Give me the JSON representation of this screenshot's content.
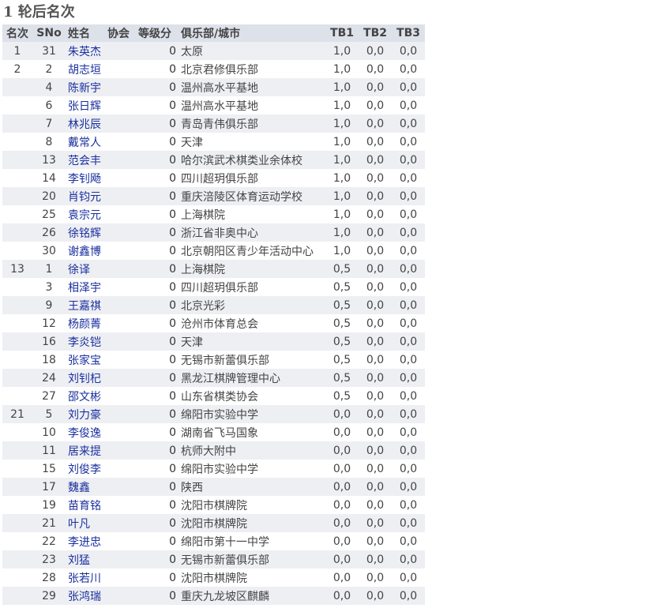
{
  "page": {
    "title": "1 轮后名次"
  },
  "table": {
    "headers": {
      "rank": "名次",
      "sno": "SNo",
      "name": "姓名",
      "fed": "协会",
      "rating": "等级分",
      "club": "俱乐部/城市",
      "tb1": "TB1",
      "tb2": "TB2",
      "tb3": "TB3"
    },
    "rows": [
      {
        "rank": "1",
        "sno": "31",
        "name": "朱英杰",
        "fed": "",
        "rating": "0",
        "club": "太原",
        "tb1": "1,0",
        "tb2": "0,0",
        "tb3": "0,0"
      },
      {
        "rank": "2",
        "sno": "2",
        "name": "胡志垣",
        "fed": "",
        "rating": "0",
        "club": "北京君修俱乐部",
        "tb1": "1,0",
        "tb2": "0,0",
        "tb3": "0,0"
      },
      {
        "rank": "",
        "sno": "4",
        "name": "陈新宇",
        "fed": "",
        "rating": "0",
        "club": "温州高水平基地",
        "tb1": "1,0",
        "tb2": "0,0",
        "tb3": "0,0"
      },
      {
        "rank": "",
        "sno": "6",
        "name": "张日辉",
        "fed": "",
        "rating": "0",
        "club": "温州高水平基地",
        "tb1": "1,0",
        "tb2": "0,0",
        "tb3": "0,0"
      },
      {
        "rank": "",
        "sno": "7",
        "name": "林兆辰",
        "fed": "",
        "rating": "0",
        "club": "青岛青伟俱乐部",
        "tb1": "1,0",
        "tb2": "0,0",
        "tb3": "0,0"
      },
      {
        "rank": "",
        "sno": "8",
        "name": "戴常人",
        "fed": "",
        "rating": "0",
        "club": "天津",
        "tb1": "1,0",
        "tb2": "0,0",
        "tb3": "0,0"
      },
      {
        "rank": "",
        "sno": "13",
        "name": "范会丰",
        "fed": "",
        "rating": "0",
        "club": "哈尔滨武术棋类业余体校",
        "tb1": "1,0",
        "tb2": "0,0",
        "tb3": "0,0"
      },
      {
        "rank": "",
        "sno": "14",
        "name": "李钊飏",
        "fed": "",
        "rating": "0",
        "club": "四川超玥俱乐部",
        "tb1": "1,0",
        "tb2": "0,0",
        "tb3": "0,0"
      },
      {
        "rank": "",
        "sno": "20",
        "name": "肖钧元",
        "fed": "",
        "rating": "0",
        "club": "重庆涪陵区体育运动学校",
        "tb1": "1,0",
        "tb2": "0,0",
        "tb3": "0,0"
      },
      {
        "rank": "",
        "sno": "25",
        "name": "袁宗元",
        "fed": "",
        "rating": "0",
        "club": "上海棋院",
        "tb1": "1,0",
        "tb2": "0,0",
        "tb3": "0,0"
      },
      {
        "rank": "",
        "sno": "26",
        "name": "徐铭辉",
        "fed": "",
        "rating": "0",
        "club": "浙江省非奥中心",
        "tb1": "1,0",
        "tb2": "0,0",
        "tb3": "0,0"
      },
      {
        "rank": "",
        "sno": "30",
        "name": "谢鑫博",
        "fed": "",
        "rating": "0",
        "club": "北京朝阳区青少年活动中心",
        "tb1": "1,0",
        "tb2": "0,0",
        "tb3": "0,0"
      },
      {
        "rank": "13",
        "sno": "1",
        "name": "徐译",
        "fed": "",
        "rating": "0",
        "club": "上海棋院",
        "tb1": "0,5",
        "tb2": "0,0",
        "tb3": "0,0"
      },
      {
        "rank": "",
        "sno": "3",
        "name": "相泽宇",
        "fed": "",
        "rating": "0",
        "club": "四川超玥俱乐部",
        "tb1": "0,5",
        "tb2": "0,0",
        "tb3": "0,0"
      },
      {
        "rank": "",
        "sno": "9",
        "name": "王嘉祺",
        "fed": "",
        "rating": "0",
        "club": "北京光彩",
        "tb1": "0,5",
        "tb2": "0,0",
        "tb3": "0,0"
      },
      {
        "rank": "",
        "sno": "12",
        "name": "杨颜菁",
        "fed": "",
        "rating": "0",
        "club": "沧州市体育总会",
        "tb1": "0,5",
        "tb2": "0,0",
        "tb3": "0,0"
      },
      {
        "rank": "",
        "sno": "16",
        "name": "李炎铠",
        "fed": "",
        "rating": "0",
        "club": "天津",
        "tb1": "0,5",
        "tb2": "0,0",
        "tb3": "0,0"
      },
      {
        "rank": "",
        "sno": "18",
        "name": "张家宝",
        "fed": "",
        "rating": "0",
        "club": "无锡市新蕾俱乐部",
        "tb1": "0,5",
        "tb2": "0,0",
        "tb3": "0,0"
      },
      {
        "rank": "",
        "sno": "24",
        "name": "刘钊杞",
        "fed": "",
        "rating": "0",
        "club": "黑龙江棋牌管理中心",
        "tb1": "0,5",
        "tb2": "0,0",
        "tb3": "0,0"
      },
      {
        "rank": "",
        "sno": "27",
        "name": "邵文彬",
        "fed": "",
        "rating": "0",
        "club": "山东省棋类协会",
        "tb1": "0,5",
        "tb2": "0,0",
        "tb3": "0,0"
      },
      {
        "rank": "21",
        "sno": "5",
        "name": "刘力豪",
        "fed": "",
        "rating": "0",
        "club": "绵阳市实验中学",
        "tb1": "0,0",
        "tb2": "0,0",
        "tb3": "0,0"
      },
      {
        "rank": "",
        "sno": "10",
        "name": "李俊逸",
        "fed": "",
        "rating": "0",
        "club": "湖南省飞马国象",
        "tb1": "0,0",
        "tb2": "0,0",
        "tb3": "0,0"
      },
      {
        "rank": "",
        "sno": "11",
        "name": "居来提",
        "fed": "",
        "rating": "0",
        "club": "杭师大附中",
        "tb1": "0,0",
        "tb2": "0,0",
        "tb3": "0,0"
      },
      {
        "rank": "",
        "sno": "15",
        "name": "刘俊李",
        "fed": "",
        "rating": "0",
        "club": "绵阳市实验中学",
        "tb1": "0,0",
        "tb2": "0,0",
        "tb3": "0,0"
      },
      {
        "rank": "",
        "sno": "17",
        "name": "魏鑫",
        "fed": "",
        "rating": "0",
        "club": "陕西",
        "tb1": "0,0",
        "tb2": "0,0",
        "tb3": "0,0"
      },
      {
        "rank": "",
        "sno": "19",
        "name": "苗育铭",
        "fed": "",
        "rating": "0",
        "club": "沈阳市棋牌院",
        "tb1": "0,0",
        "tb2": "0,0",
        "tb3": "0,0"
      },
      {
        "rank": "",
        "sno": "21",
        "name": "叶凡",
        "fed": "",
        "rating": "0",
        "club": "沈阳市棋牌院",
        "tb1": "0,0",
        "tb2": "0,0",
        "tb3": "0,0"
      },
      {
        "rank": "",
        "sno": "22",
        "name": "李进忠",
        "fed": "",
        "rating": "0",
        "club": "绵阳市第十一中学",
        "tb1": "0,0",
        "tb2": "0,0",
        "tb3": "0,0"
      },
      {
        "rank": "",
        "sno": "23",
        "name": "刘猛",
        "fed": "",
        "rating": "0",
        "club": "无锡市新蕾俱乐部",
        "tb1": "0,0",
        "tb2": "0,0",
        "tb3": "0,0"
      },
      {
        "rank": "",
        "sno": "28",
        "name": "张若川",
        "fed": "",
        "rating": "0",
        "club": "沈阳市棋牌院",
        "tb1": "0,0",
        "tb2": "0,0",
        "tb3": "0,0"
      },
      {
        "rank": "",
        "sno": "29",
        "name": "张鸿瑞",
        "fed": "",
        "rating": "0",
        "club": "重庆九龙坡区麒麟",
        "tb1": "0,0",
        "tb2": "0,0",
        "tb3": "0,0"
      }
    ]
  }
}
